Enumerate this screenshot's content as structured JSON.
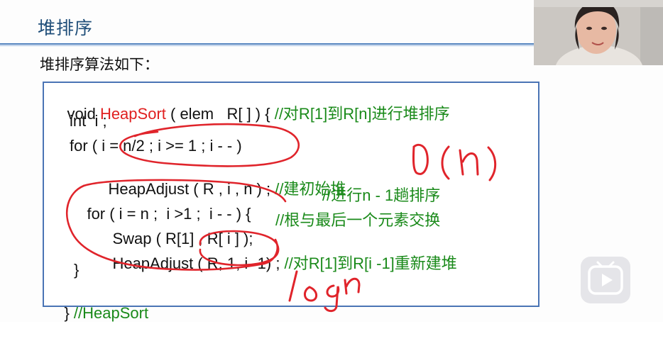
{
  "slide": {
    "title": "堆排序",
    "subtitle": "堆排序算法如下："
  },
  "code": {
    "l1_a": "void ",
    "l1_fn": "HeapSort",
    "l1_b": " ( elem   R[ ] ) {",
    "l1_cm": " //对R[1]到R[n]进行堆排序",
    "l2": "int  i ;",
    "l3": "for ( i = n/2 ; i >= 1 ; i - - )",
    "l4_code": "HeapAdjust ( R , i , n ) ;",
    "l4_cm": " //建初始堆",
    "l5_code": "for ( i = n ;  i >1 ;  i - - ) {",
    "l5_cm": "//进行n - 1趟排序",
    "l6_code": "Swap ( R[1] , R[ i ] );",
    "l6_cm": "//根与最后一个元素交换",
    "l7_code": "HeapAdjust ( R, 1, i -1) ;",
    "l7_cm": " //对R[1]到R[i -1]重新建堆",
    "l8": "}",
    "l9_a": "} ",
    "l9_cm": "//HeapSort"
  },
  "annotations": {
    "on": "O(n)",
    "logn": "logn"
  },
  "colors": {
    "title": "#1f4e79",
    "code_border": "#4a74b5",
    "function_name": "#e02020",
    "comment": "#1a8a1a",
    "ink": "#e0242b"
  },
  "icons": {
    "video_play": "play-icon"
  }
}
